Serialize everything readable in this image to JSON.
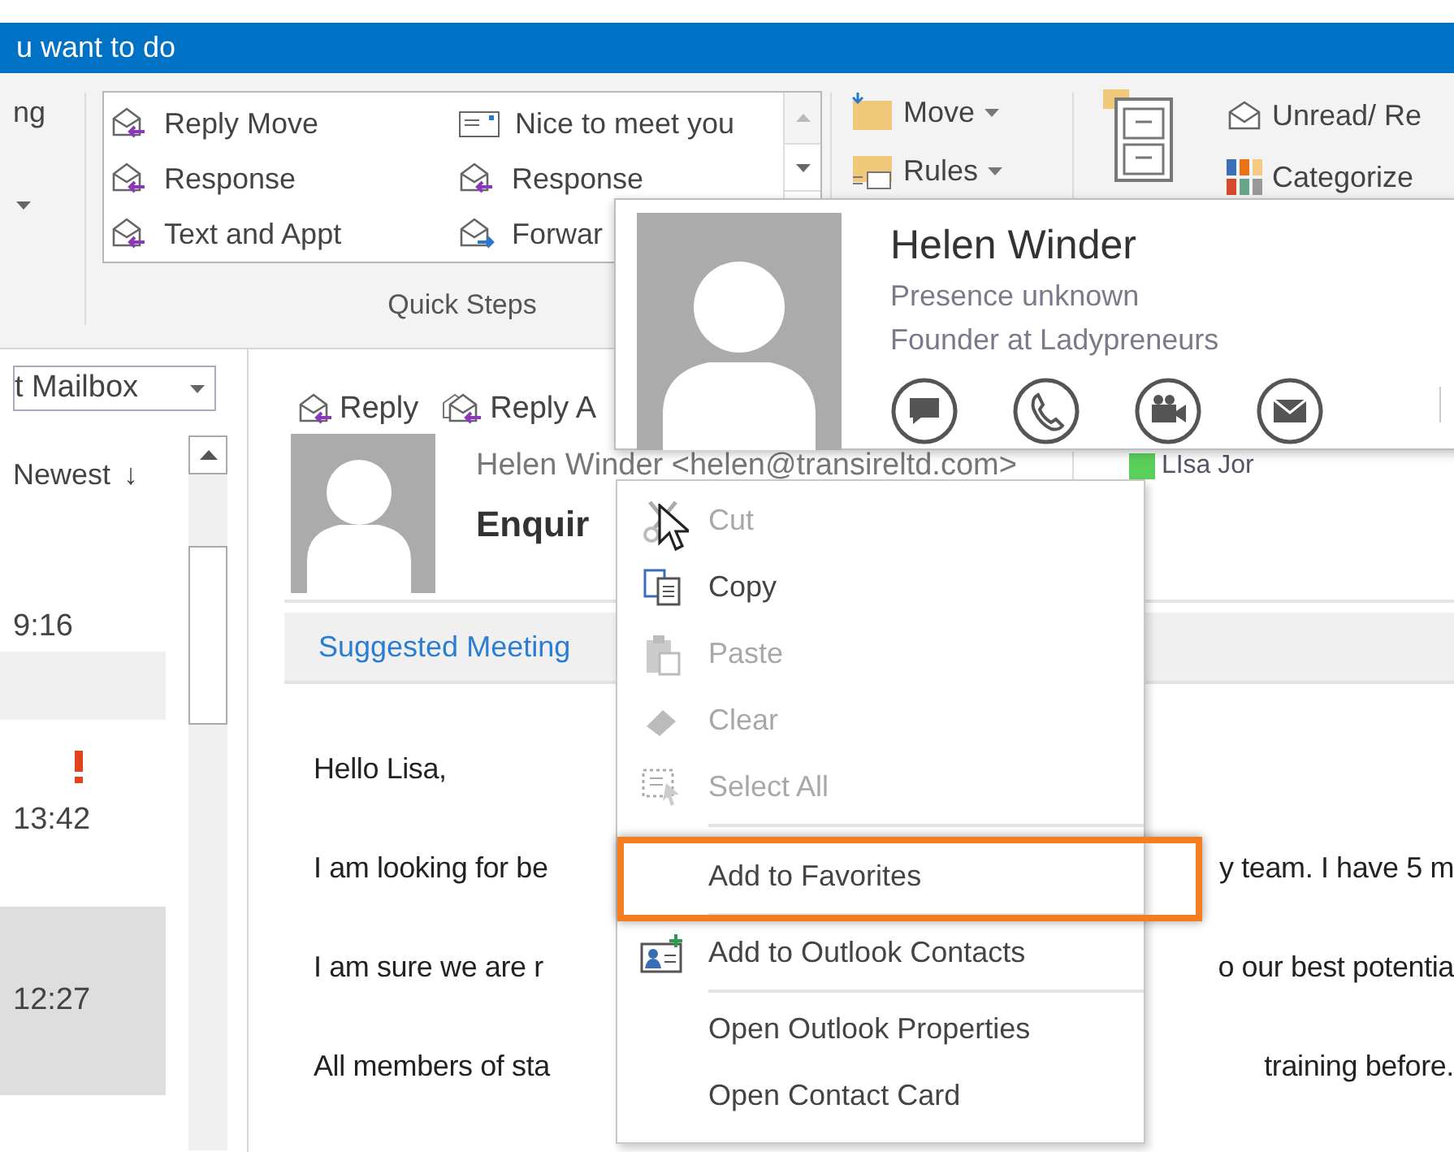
{
  "title_bar": {
    "search_hint": "u want to do"
  },
  "ribbon": {
    "left_group": {
      "label": "ng"
    },
    "quick_steps": {
      "label": "Quick Steps",
      "items": [
        {
          "label": "Reply Move",
          "kind": "reply"
        },
        {
          "label": "Response",
          "kind": "reply"
        },
        {
          "label": "Text and Appt",
          "kind": "reply"
        },
        {
          "label": "Nice to meet you",
          "kind": "note"
        },
        {
          "label": "Response",
          "kind": "reply"
        },
        {
          "label": "Forwar",
          "kind": "forward"
        }
      ]
    },
    "move_group": [
      {
        "label": "Move",
        "kind": "move"
      },
      {
        "label": "Rules",
        "kind": "rules"
      }
    ],
    "tags_group": [
      {
        "label": "Unread/ Re",
        "kind": "unread"
      },
      {
        "label": "Categorize",
        "kind": "categorize"
      }
    ]
  },
  "mail_list": {
    "folder": "t Mailbox",
    "sort": "Newest",
    "sort_arrow": "↓",
    "messages": [
      {
        "time": "9:16",
        "important": false,
        "selected": false
      },
      {
        "time": "13:42",
        "important": true,
        "selected": false
      },
      {
        "time": "12:27",
        "important": false,
        "selected": true
      }
    ]
  },
  "reading_pane": {
    "actions": [
      "Reply",
      "Reply A"
    ],
    "sender": "Helen Winder <helen@transireltd.com>",
    "recipient": {
      "name": "LIsa Jor",
      "color": "#5ad05a"
    },
    "subject": "Enquir",
    "suggested_meetings": "Suggested Meeting",
    "body": [
      {
        "left": "Hello Lisa,"
      },
      {
        "left": "I am looking for be",
        "right": "y team. I have 5 m"
      },
      {
        "left": "I am sure we are r",
        "right": "o our best potentia"
      },
      {
        "left": "All members of sta",
        "right": "training before."
      }
    ]
  },
  "contact_card": {
    "name": "Helen Winder",
    "presence": "Presence unknown",
    "position": "Founder at Ladypreneurs"
  },
  "context_menu": [
    {
      "kind": "item",
      "label": "Cut",
      "disabled": true,
      "highlighted": false
    },
    {
      "kind": "item",
      "label": "Copy",
      "disabled": false,
      "highlighted": false
    },
    {
      "kind": "item",
      "label": "Paste",
      "disabled": true,
      "highlighted": false
    },
    {
      "kind": "item",
      "label": "Clear",
      "disabled": true,
      "highlighted": false
    },
    {
      "kind": "item",
      "label": "Select All",
      "disabled": true,
      "highlighted": false
    },
    {
      "kind": "separator"
    },
    {
      "kind": "item",
      "label": "Add to Favorites",
      "disabled": false,
      "highlighted": true
    },
    {
      "kind": "separator"
    },
    {
      "kind": "item",
      "label": "Add to Outlook Contacts",
      "disabled": false,
      "highlighted": false
    },
    {
      "kind": "separator"
    },
    {
      "kind": "item",
      "label": "Open Outlook Properties",
      "disabled": false,
      "highlighted": false
    },
    {
      "kind": "item",
      "label": "Open Contact Card",
      "disabled": false,
      "highlighted": false
    }
  ]
}
